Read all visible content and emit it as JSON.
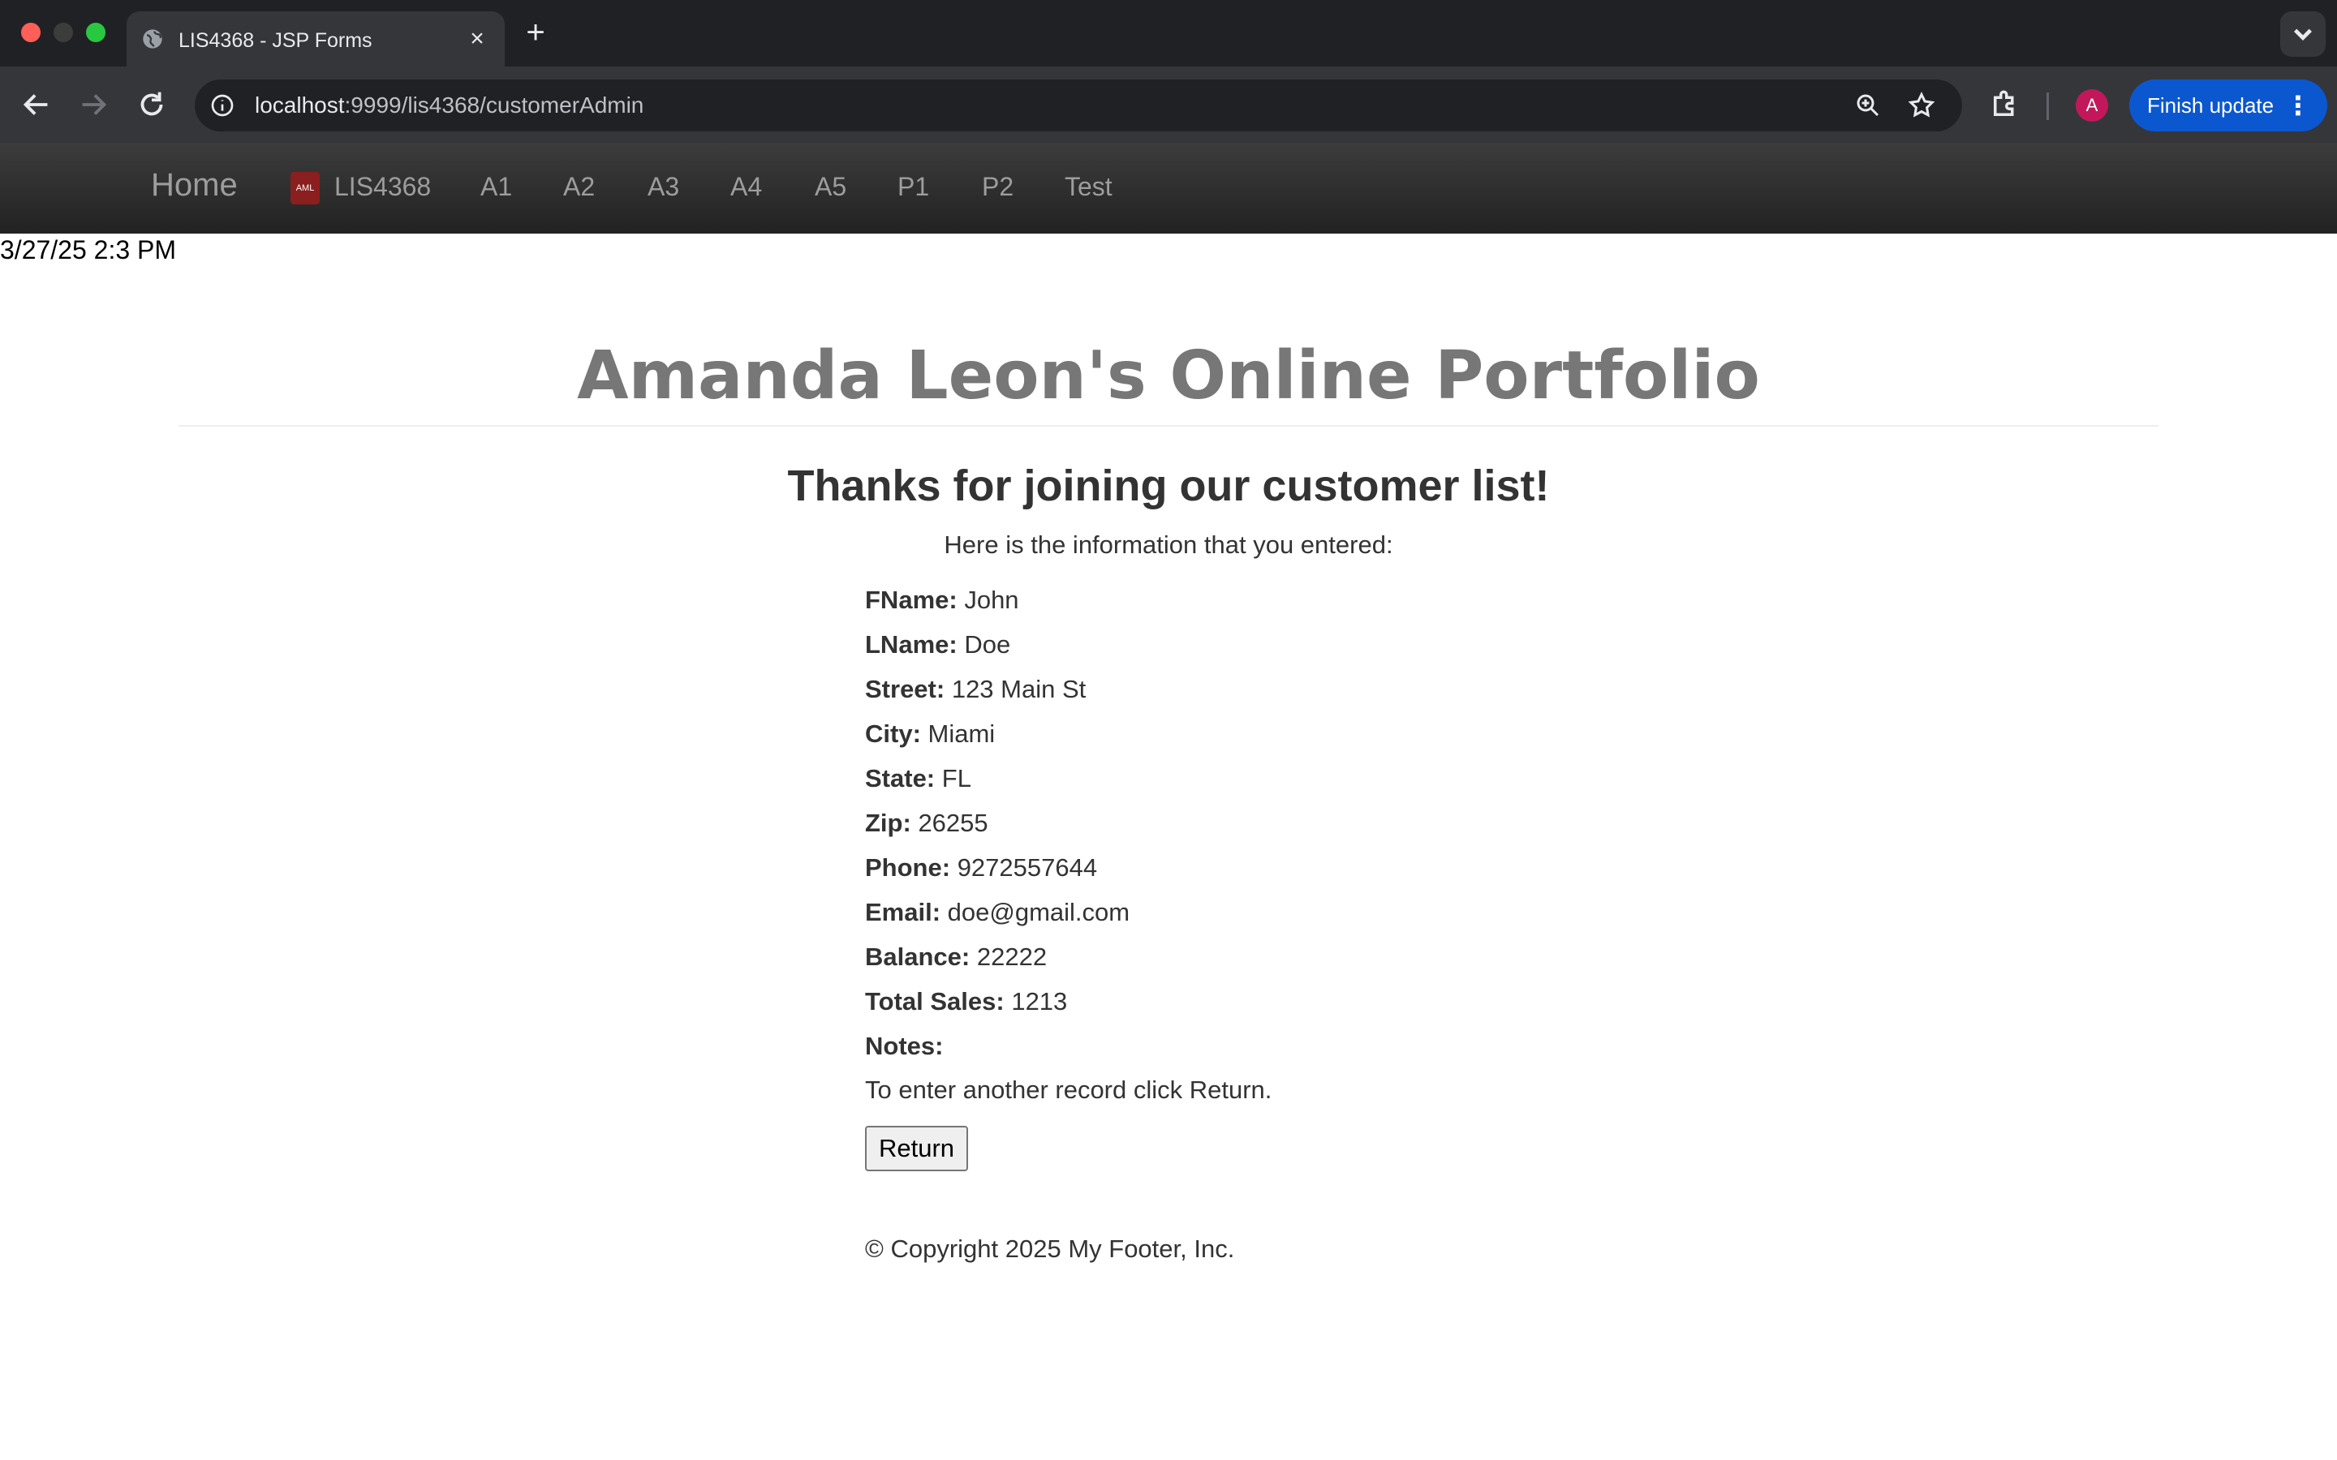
{
  "browser": {
    "tab_title": "LIS4368 - JSP Forms",
    "close_glyph": "×",
    "newtab_glyph": "+",
    "url_host": "localhost",
    "url_path": ":9999/lis4368/customerAdmin",
    "update_label": "Finish update",
    "update_dots": "⋮",
    "avatar_letter": "A",
    "accent_color": "#0b57d0"
  },
  "nav": {
    "brand": "Home",
    "logo_text": "AML",
    "links": [
      "LIS4368",
      "A1",
      "A2",
      "A3",
      "A4",
      "A5",
      "P1",
      "P2",
      "Test"
    ]
  },
  "datestamp": "3/27/25 2:3 PM",
  "main": {
    "title": "Amanda Leon's Online Portfolio",
    "heading": "Thanks for joining our customer list!",
    "intro": "Here is the information that you entered:",
    "fields": [
      {
        "label": "FName:",
        "value": "John"
      },
      {
        "label": "LName:",
        "value": "Doe"
      },
      {
        "label": "Street:",
        "value": "123 Main St"
      },
      {
        "label": "City:",
        "value": "Miami"
      },
      {
        "label": "State:",
        "value": "FL"
      },
      {
        "label": "Zip:",
        "value": "26255"
      },
      {
        "label": "Phone:",
        "value": "9272557644"
      },
      {
        "label": "Email:",
        "value": "doe@gmail.com"
      },
      {
        "label": "Balance:",
        "value": "22222"
      },
      {
        "label": "Total Sales:",
        "value": "1213"
      },
      {
        "label": "Notes:",
        "value": ""
      }
    ],
    "return_text": "To enter another record click Return.",
    "return_button": "Return",
    "footer": "© Copyright 2025 My Footer, Inc."
  }
}
